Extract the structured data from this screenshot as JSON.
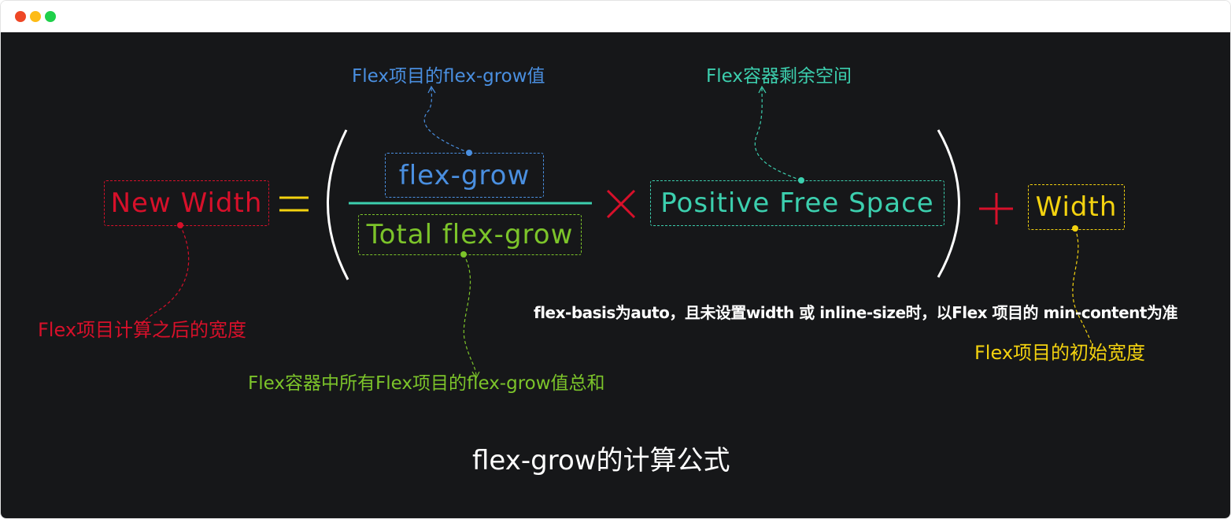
{
  "window": {
    "controls": [
      "close",
      "minimize",
      "maximize"
    ]
  },
  "colors": {
    "red": "#d7102a",
    "yellow": "#f3d20f",
    "blue": "#4a8fe0",
    "green": "#7cc42a",
    "teal": "#3ccfae",
    "white": "#ffffff",
    "background": "#161719"
  },
  "formula": {
    "result": "New Width",
    "equals": "=",
    "numerator": "flex-grow",
    "denominator": "Total flex-grow",
    "times": "×",
    "free_space": "Positive Free Space",
    "plus": "+",
    "width": "Width"
  },
  "annotations": {
    "numerator": "Flex项目的flex-grow值",
    "free_space": "Flex容器剩余空间",
    "result": "Flex项目计算之后的宽度",
    "denominator": "Flex容器中所有Flex项目的flex-grow值总和",
    "width_note": "flex-basis为auto，且未设置width 或 inline-size时，以Flex 项目的 min-content为准",
    "width": "Flex项目的初始宽度"
  },
  "title": "flex-grow的计算公式"
}
